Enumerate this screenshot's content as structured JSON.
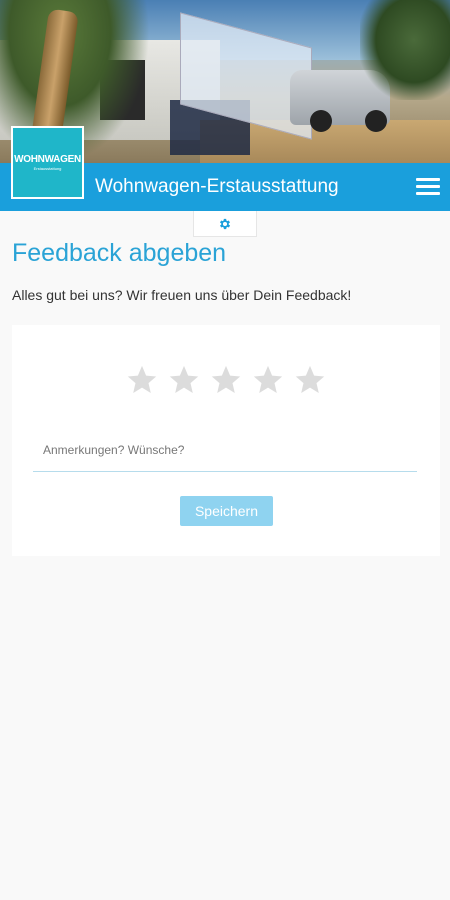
{
  "header": {
    "logo_text": "WOHNWAGEN",
    "logo_subtext": "Erstausstattung",
    "title": "Wohnwagen-Erstausstattung",
    "menu_icon": "hamburger-menu-icon",
    "accent_color": "#1a9fdc"
  },
  "settings_tab": {
    "icon": "gear-icon",
    "icon_color": "#1a9fdc"
  },
  "main": {
    "title": "Feedback abgeben",
    "intro": "Alles gut bei uns? Wir freuen uns über Dein Feedback!"
  },
  "feedback_form": {
    "rating_max": 5,
    "rating_value": 0,
    "star_color": "#dcdcdc",
    "comment_placeholder": "Anmerkungen? Wünsche?",
    "comment_value": "",
    "save_label": "Speichern",
    "save_color": "#8fd3f0"
  }
}
